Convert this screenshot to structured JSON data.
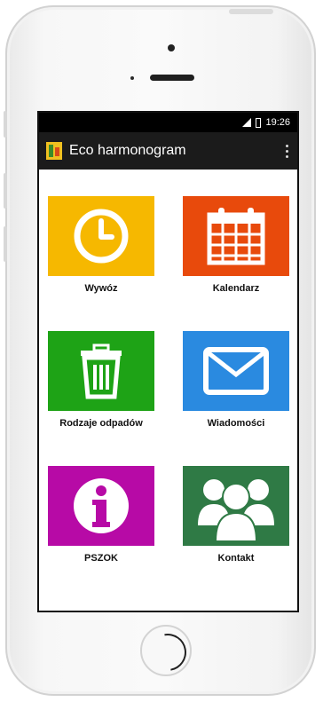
{
  "app": {
    "title": "Eco harmonogram"
  },
  "status_bar": {
    "time": "19:26"
  },
  "tiles": [
    {
      "label": "Wywóz",
      "color": "#f6b800",
      "icon": "clock-icon"
    },
    {
      "label": "Kalendarz",
      "color": "#e84a0c",
      "icon": "calendar-icon"
    },
    {
      "label": "Rodzaje odpadów",
      "color": "#1ea316",
      "icon": "trash-icon"
    },
    {
      "label": "Wiadomości",
      "color": "#2a8ae0",
      "icon": "mail-icon"
    },
    {
      "label": "PSZOK",
      "color": "#b70aa6",
      "icon": "info-icon"
    },
    {
      "label": "Kontakt",
      "color": "#2f7a45",
      "icon": "people-icon"
    }
  ]
}
